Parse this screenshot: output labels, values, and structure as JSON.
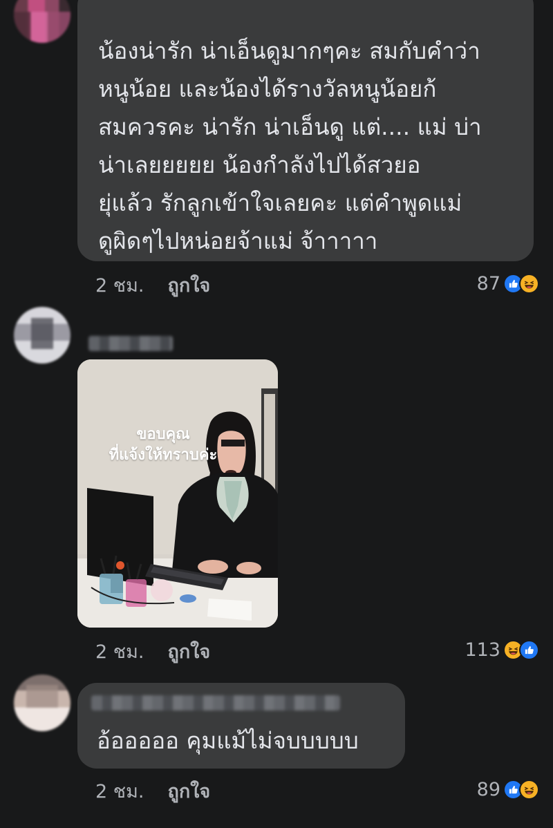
{
  "comments": [
    {
      "text": "น้องน่ารัก น่าเอ็นดูมากๆคะ  สมกับคำว่า\nหนูน้อย  และน้องได้รางวัลหนูน้อยก้\nสมควรคะ  น่ารัก น่าเอ็นดู   แต่.... แม่ บ่า\nน่าเลยยยยย  น้องกำลังไปได้สวยอ\nยุ่แล้ว  รักลูกเข้าใจเลยคะ  แต่คำพูดแม่\nดูผิดๆไปหน่อยจ้าแม่  จ้าาาาา",
      "time": "2 ชม.",
      "like_label": "ถูกใจ",
      "reaction_count": "87"
    },
    {
      "image_caption": "ขอบคุณ\nที่แจ้งให้ทราบค่ะ",
      "time": "2 ชม.",
      "like_label": "ถูกใจ",
      "reaction_count": "113"
    },
    {
      "text": "อ้อออออ คุมแม้ไม่จบบบบบ",
      "time": "2 ชม.",
      "like_label": "ถูกใจ",
      "reaction_count": "89"
    }
  ],
  "icons": {
    "like": "like-reaction-icon",
    "haha": "haha-reaction-icon"
  },
  "colors": {
    "background": "#18191a",
    "bubble": "#3a3b3c",
    "text": "#e4e6eb",
    "muted": "#b0b3b8",
    "like_blue": "#2078f4",
    "haha_yellow": "#f7b125"
  }
}
